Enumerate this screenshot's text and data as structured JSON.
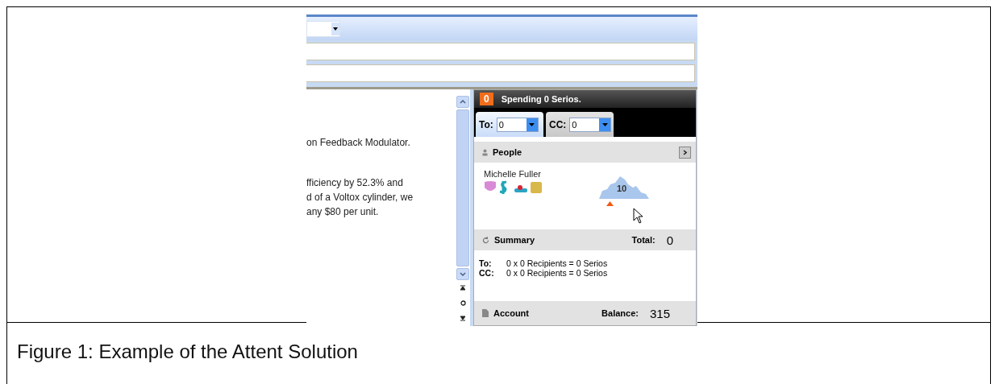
{
  "figure": {
    "caption": "Figure 1: Example of the Attent Solution"
  },
  "document": {
    "lines": [
      "on Feedback Modulator.",
      "fficiency by 52.3% and",
      "d of a Voltox cylinder, we",
      "any $80 per unit."
    ]
  },
  "panel": {
    "badge": "0",
    "title": "Spending 0 Serios.",
    "tabs": [
      {
        "label": "To:",
        "value": "0",
        "selected": true
      },
      {
        "label": "CC:",
        "value": "0",
        "selected": false
      }
    ],
    "people": {
      "title": "People",
      "name": "Michelle Fuller",
      "gauge_value": "10"
    },
    "summary": {
      "title": "Summary",
      "total_label": "Total:",
      "total": "0",
      "rows": [
        {
          "label": "To:",
          "text": "0 x 0 Recipients = 0 Serios"
        },
        {
          "label": "CC:",
          "text": "0 x 0 Recipients = 0 Serios"
        }
      ]
    },
    "account": {
      "title": "Account",
      "balance_label": "Balance:",
      "balance": "315"
    }
  }
}
